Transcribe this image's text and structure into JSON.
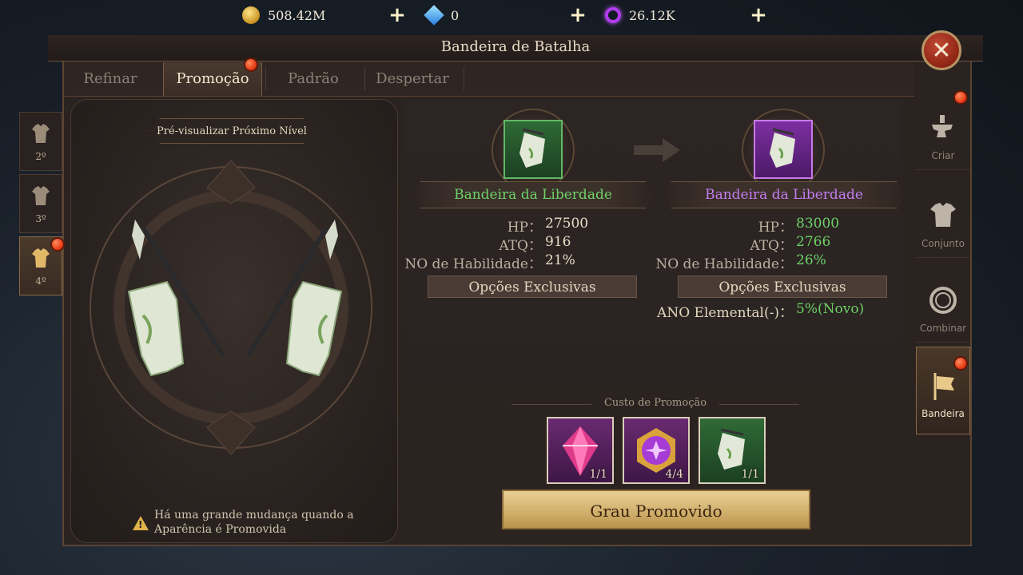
{
  "currency": {
    "gold": "508.42M",
    "diamonds": "0",
    "void_crystal": "26.12K"
  },
  "window": {
    "title": "Bandeira de Batalha"
  },
  "tabs": [
    {
      "label": "Refinar",
      "active": false
    },
    {
      "label": "Promoção",
      "active": true
    },
    {
      "label": "Padrão",
      "active": false
    },
    {
      "label": "Despertar",
      "active": false
    }
  ],
  "levels": [
    {
      "label": "2º",
      "active": false
    },
    {
      "label": "3º",
      "active": false
    },
    {
      "label": "4º",
      "active": true
    }
  ],
  "preview": {
    "label": "Pré-visualizar Próximo Nível",
    "note_line1": "Há uma grande mudança quando a",
    "note_line2": "Aparência é Promovida"
  },
  "current": {
    "name": "Bandeira da Liberdade",
    "name_color": "#6ed168",
    "stats": [
      {
        "key": "HP：",
        "value": "27500"
      },
      {
        "key": "ATQ：",
        "value": "916"
      },
      {
        "key": "NO de Habilidade：",
        "value": "21%"
      }
    ],
    "options_label": "Opções Exclusivas"
  },
  "next": {
    "name": "Bandeira da Liberdade",
    "name_color": "#c27df0",
    "stats": [
      {
        "key": "HP：",
        "value": "83000"
      },
      {
        "key": "ATQ：",
        "value": "2766"
      },
      {
        "key": "NO de Habilidade：",
        "value": "26%"
      }
    ],
    "options_label": "Opções Exclusivas",
    "exclusive_option": {
      "key": "ANO Elemental(-)：",
      "value": "5%(Novo)"
    }
  },
  "cost": {
    "label": "Custo de Promoção",
    "items": [
      {
        "icon": "pink-crystal-icon",
        "count": "1/1"
      },
      {
        "icon": "purple-gem-icon",
        "count": "4/4"
      },
      {
        "icon": "green-banner-icon",
        "count": "1/1"
      }
    ]
  },
  "action": {
    "label": "Grau Promovido"
  },
  "side_nav": [
    {
      "label": "Criar",
      "icon": "anvil-icon",
      "active": false
    },
    {
      "label": "Conjunto",
      "icon": "armor-set-icon",
      "active": false
    },
    {
      "label": "Combinar",
      "icon": "ring-icon",
      "active": false
    },
    {
      "label": "Bandeira",
      "icon": "banner-icon",
      "active": true
    }
  ]
}
